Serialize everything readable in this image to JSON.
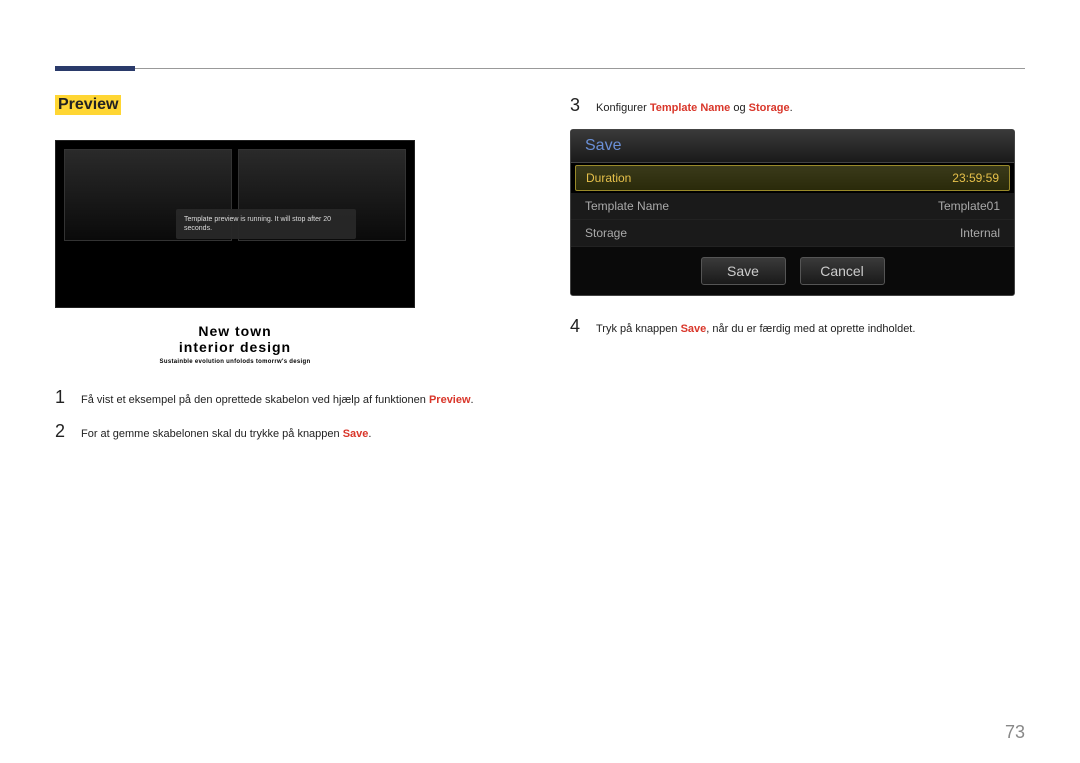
{
  "section_title": "Preview",
  "preview": {
    "tooltip": "Template preview is running. It will stop after 20 seconds.",
    "caption_line1": "New town",
    "caption_line2": "interior design",
    "caption_line3": "Sustainble evolution unfolods tomorrw's design"
  },
  "steps_left": [
    {
      "num": "1",
      "prefix": "Få vist et eksempel på den oprettede skabelon ved hjælp af funktionen ",
      "highlight": "Preview",
      "suffix": "."
    },
    {
      "num": "2",
      "prefix": "For at gemme skabelonen skal du trykke på knappen ",
      "highlight": "Save",
      "suffix": "."
    }
  ],
  "steps_right": [
    {
      "num": "3",
      "prefix": "Konfigurer ",
      "h1": "Template Name",
      "mid": " og ",
      "h2": "Storage",
      "suffix": "."
    }
  ],
  "step4": {
    "num": "4",
    "prefix": "Tryk på knappen ",
    "highlight": "Save",
    "suffix": ", når du er færdig med at oprette indholdet."
  },
  "dialog": {
    "title": "Save",
    "rows": [
      {
        "label": "Duration",
        "value": "23:59:59",
        "selected": true
      },
      {
        "label": "Template Name",
        "value": "Template01",
        "selected": false
      },
      {
        "label": "Storage",
        "value": "Internal",
        "selected": false
      }
    ],
    "save_btn": "Save",
    "cancel_btn": "Cancel"
  },
  "page_number": "73"
}
